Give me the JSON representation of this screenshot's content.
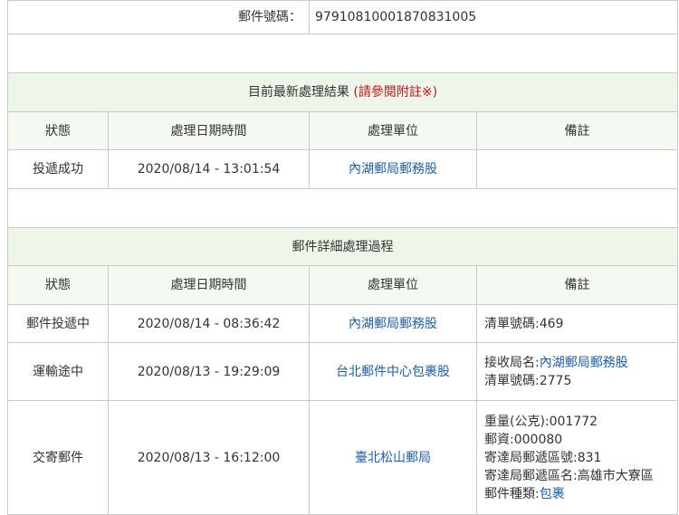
{
  "mail_number": {
    "label": "郵件號碼：",
    "value": "97910810001870831005"
  },
  "latest": {
    "title": "目前最新處理結果",
    "note": "(請參閱附註※)",
    "headers": [
      "狀態",
      "處理日期時間",
      "處理單位",
      "備註"
    ],
    "row": {
      "status": "投遞成功",
      "datetime": "2020/08/14 - 13:01:54",
      "unit": "內湖郵局郵務股",
      "remark": ""
    }
  },
  "detail": {
    "title": "郵件詳細處理過程",
    "headers": [
      "狀態",
      "處理日期時間",
      "處理單位",
      "備註"
    ],
    "rows": [
      {
        "status": "郵件投遞中",
        "datetime": "2020/08/14 - 08:36:42",
        "unit": "內湖郵局郵務股",
        "remark": {
          "line1_label": "清單號碼:469"
        }
      },
      {
        "status": "運輸途中",
        "datetime": "2020/08/13 - 19:29:09",
        "unit": "台北郵件中心包裹股",
        "remark": {
          "line1_label": "接收局名:",
          "line1_link": "內湖郵局郵務股",
          "line2": "清單號碼:2775"
        }
      },
      {
        "status": "交寄郵件",
        "datetime": "2020/08/13 - 16:12:00",
        "unit": "臺北松山郵局",
        "remark": {
          "line1": "重量(公克):001772",
          "line2": "郵資:000080",
          "line3": "寄達局郵遞區號:831",
          "line4": "寄達局郵遞區名:高雄市大寮區",
          "line5_label": "郵件種類:",
          "line5_link": "包裹"
        }
      }
    ]
  }
}
